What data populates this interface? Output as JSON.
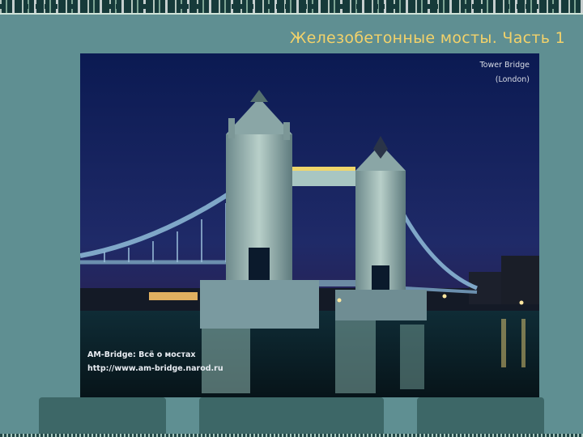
{
  "slide": {
    "title": "Железобетонные мосты.  Часть 1"
  },
  "photo": {
    "caption_top_line1": "Tower Bridge",
    "caption_top_line2": "(London)",
    "caption_bottom_line1": "AM-Bridge: Всё о мостах",
    "caption_bottom_line2": "http://www.am-bridge.narod.ru"
  },
  "colors": {
    "background": "#5f8f92",
    "title": "#f3d26a",
    "tabs": "#3d6767"
  }
}
